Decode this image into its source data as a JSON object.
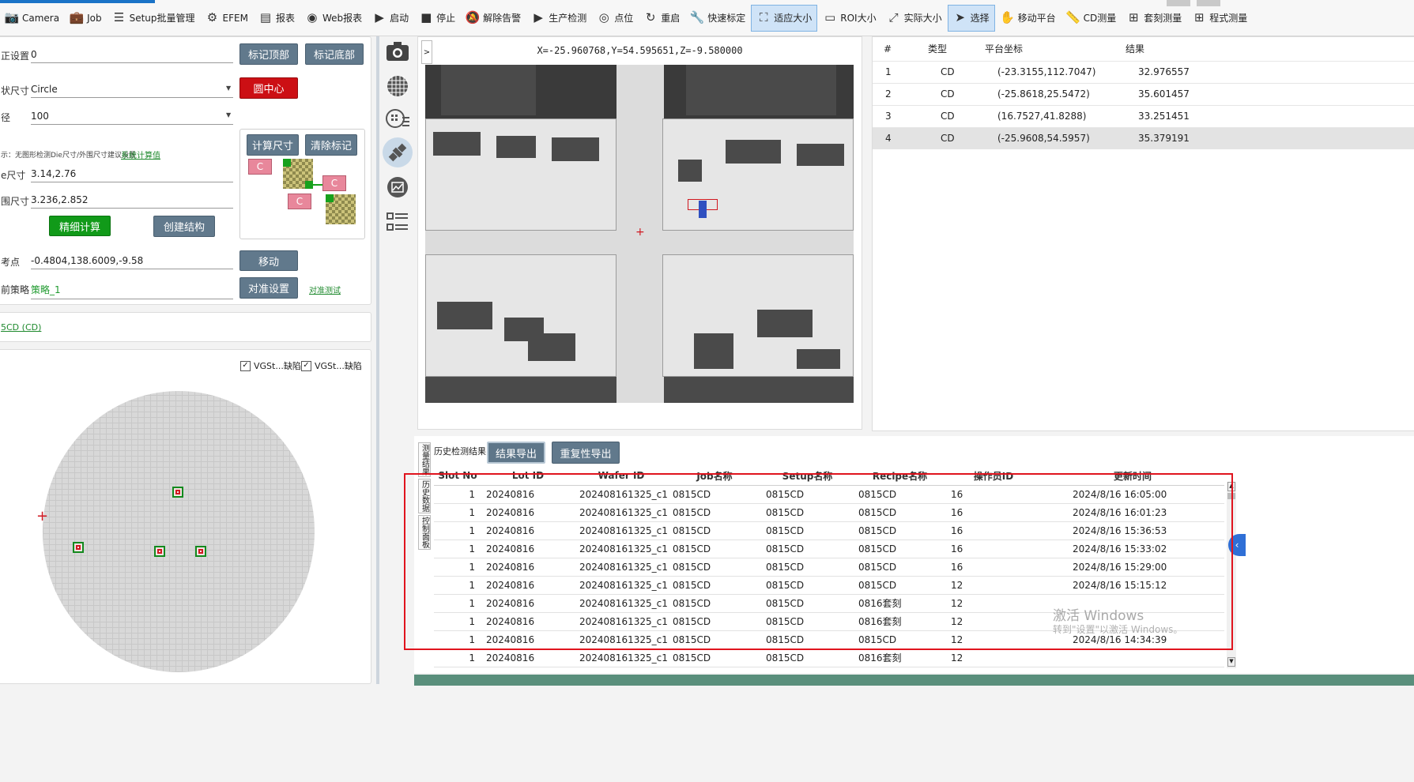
{
  "toolbar": {
    "items": [
      {
        "label": "Camera",
        "icon": "camera-icon"
      },
      {
        "label": "Job",
        "icon": "briefcase-icon"
      },
      {
        "label": "Setup批量管理",
        "icon": "checklist-icon"
      },
      {
        "label": "EFEM",
        "icon": "robot-arm-icon"
      },
      {
        "label": "报表",
        "icon": "report-icon"
      },
      {
        "label": "Web报表",
        "icon": "web-report-icon"
      },
      {
        "label": "启动",
        "icon": "play-icon"
      },
      {
        "label": "停止",
        "icon": "stop-icon"
      },
      {
        "label": "解除告警",
        "icon": "bell-off-icon"
      },
      {
        "label": "生产检测",
        "icon": "play-icon"
      },
      {
        "label": "点位",
        "icon": "map-pin-icon"
      },
      {
        "label": "重启",
        "icon": "refresh-icon"
      },
      {
        "label": "快速标定",
        "icon": "wrench-icon"
      },
      {
        "label": "适应大小",
        "icon": "fit-size-icon"
      },
      {
        "label": "ROI大小",
        "icon": "roi-rect-icon"
      },
      {
        "label": "实际大小",
        "icon": "actual-size-icon"
      },
      {
        "label": "选择",
        "icon": "cursor-icon"
      },
      {
        "label": "移动平台",
        "icon": "hand-icon"
      },
      {
        "label": "CD测量",
        "icon": "ruler-icon"
      },
      {
        "label": "套刻测量",
        "icon": "plus-square-icon"
      },
      {
        "label": "程式测量",
        "icon": "plus-square-icon"
      }
    ]
  },
  "left": {
    "fields": {
      "correction_label": "正设置",
      "correction_value": "0",
      "shape_label": "状尺寸",
      "shape_value": "Circle",
      "diameter_label": "径",
      "diameter_value": "100",
      "hint_text": "示：无图形检测Die尺寸/外围尺寸建议设置",
      "hint_link": "系统计算值",
      "die_label": "e尺寸",
      "die_value": "3.14,2.76",
      "outer_label": "围尺寸",
      "outer_value": "3.236,2.852",
      "ref_label": "考点",
      "ref_value": "-0.4804,138.6009,-9.58",
      "strategy_label": "前策略",
      "strategy_value": "策略_1",
      "strategy_link": "对准测试"
    },
    "buttons": {
      "mark_top": "标记顶部",
      "mark_bottom": "标记底部",
      "circle_center": "圆中心",
      "calc_size": "计算尺寸",
      "clear_mark": "清除标记",
      "fine_calc": "精细计算",
      "create_struct": "创建结构",
      "move": "移动",
      "align_setup": "对准设置"
    },
    "chip_label": "C",
    "recipe_link": "5CD (CD)",
    "checkboxes": [
      "VGSt...缺陷",
      "VGSt...缺陷"
    ],
    "check_mark": "✓"
  },
  "viewer": {
    "coord_text": "X=-25.960768,Y=54.595651,Z=-9.580000",
    "expand_label": ">"
  },
  "results": {
    "headers": [
      "#",
      "类型",
      "平台坐标",
      "结果"
    ],
    "rows": [
      [
        "1",
        "CD",
        "(-23.3155,112.7047)",
        "32.976557"
      ],
      [
        "2",
        "CD",
        "(-25.8618,25.5472)",
        "35.601457"
      ],
      [
        "3",
        "CD",
        "(16.7527,41.8288)",
        "33.251451"
      ],
      [
        "4",
        "CD",
        "(-25.9608,54.5957)",
        "35.379191"
      ]
    ]
  },
  "history": {
    "title": "历史检测结果",
    "export_result": "结果导出",
    "export_repeat": "重复性导出",
    "vtabs": [
      "测量结果",
      "历史数据",
      "控制面板"
    ],
    "headers": [
      "Slot No",
      "Lot ID",
      "Wafer ID",
      "Job名称",
      "Setup名称",
      "Recipe名称",
      "操作员ID",
      "更新时间"
    ],
    "rows": [
      [
        "1",
        "20240816",
        "202408161325_c1",
        "0815CD",
        "0815CD",
        "0815CD",
        "16",
        "2024/8/16 16:05:00"
      ],
      [
        "1",
        "20240816",
        "202408161325_c1",
        "0815CD",
        "0815CD",
        "0815CD",
        "16",
        "2024/8/16 16:01:23"
      ],
      [
        "1",
        "20240816",
        "202408161325_c1",
        "0815CD",
        "0815CD",
        "0815CD",
        "16",
        "2024/8/16 15:36:53"
      ],
      [
        "1",
        "20240816",
        "202408161325_c1",
        "0815CD",
        "0815CD",
        "0815CD",
        "16",
        "2024/8/16 15:33:02"
      ],
      [
        "1",
        "20240816",
        "202408161325_c1",
        "0815CD",
        "0815CD",
        "0815CD",
        "16",
        "2024/8/16 15:29:00"
      ],
      [
        "1",
        "20240816",
        "202408161325_c1",
        "0815CD",
        "0815CD",
        "0815CD",
        "12",
        "2024/8/16 15:15:12"
      ],
      [
        "1",
        "20240816",
        "202408161325_c1",
        "0815CD",
        "0815CD",
        "0816套刻",
        "12",
        ""
      ],
      [
        "1",
        "20240816",
        "202408161325_c1",
        "0815CD",
        "0815CD",
        "0816套刻",
        "12",
        ""
      ],
      [
        "1",
        "20240816",
        "202408161325_c1",
        "0815CD",
        "0815CD",
        "0815CD",
        "12",
        "2024/8/16 14:34:39"
      ],
      [
        "1",
        "20240816",
        "202408161325_c1",
        "0815CD",
        "0815CD",
        "0816套刻",
        "12",
        ""
      ]
    ]
  },
  "watermark": {
    "line1": "激活 Windows",
    "line2": "转到\"设置\"以激活 Windows。"
  },
  "colors": {
    "accent_blue": "#1a73c7",
    "highlight_red": "#e0141e",
    "button_slate": "#61798c",
    "button_green": "#119a19",
    "button_red": "#cc0f14"
  }
}
